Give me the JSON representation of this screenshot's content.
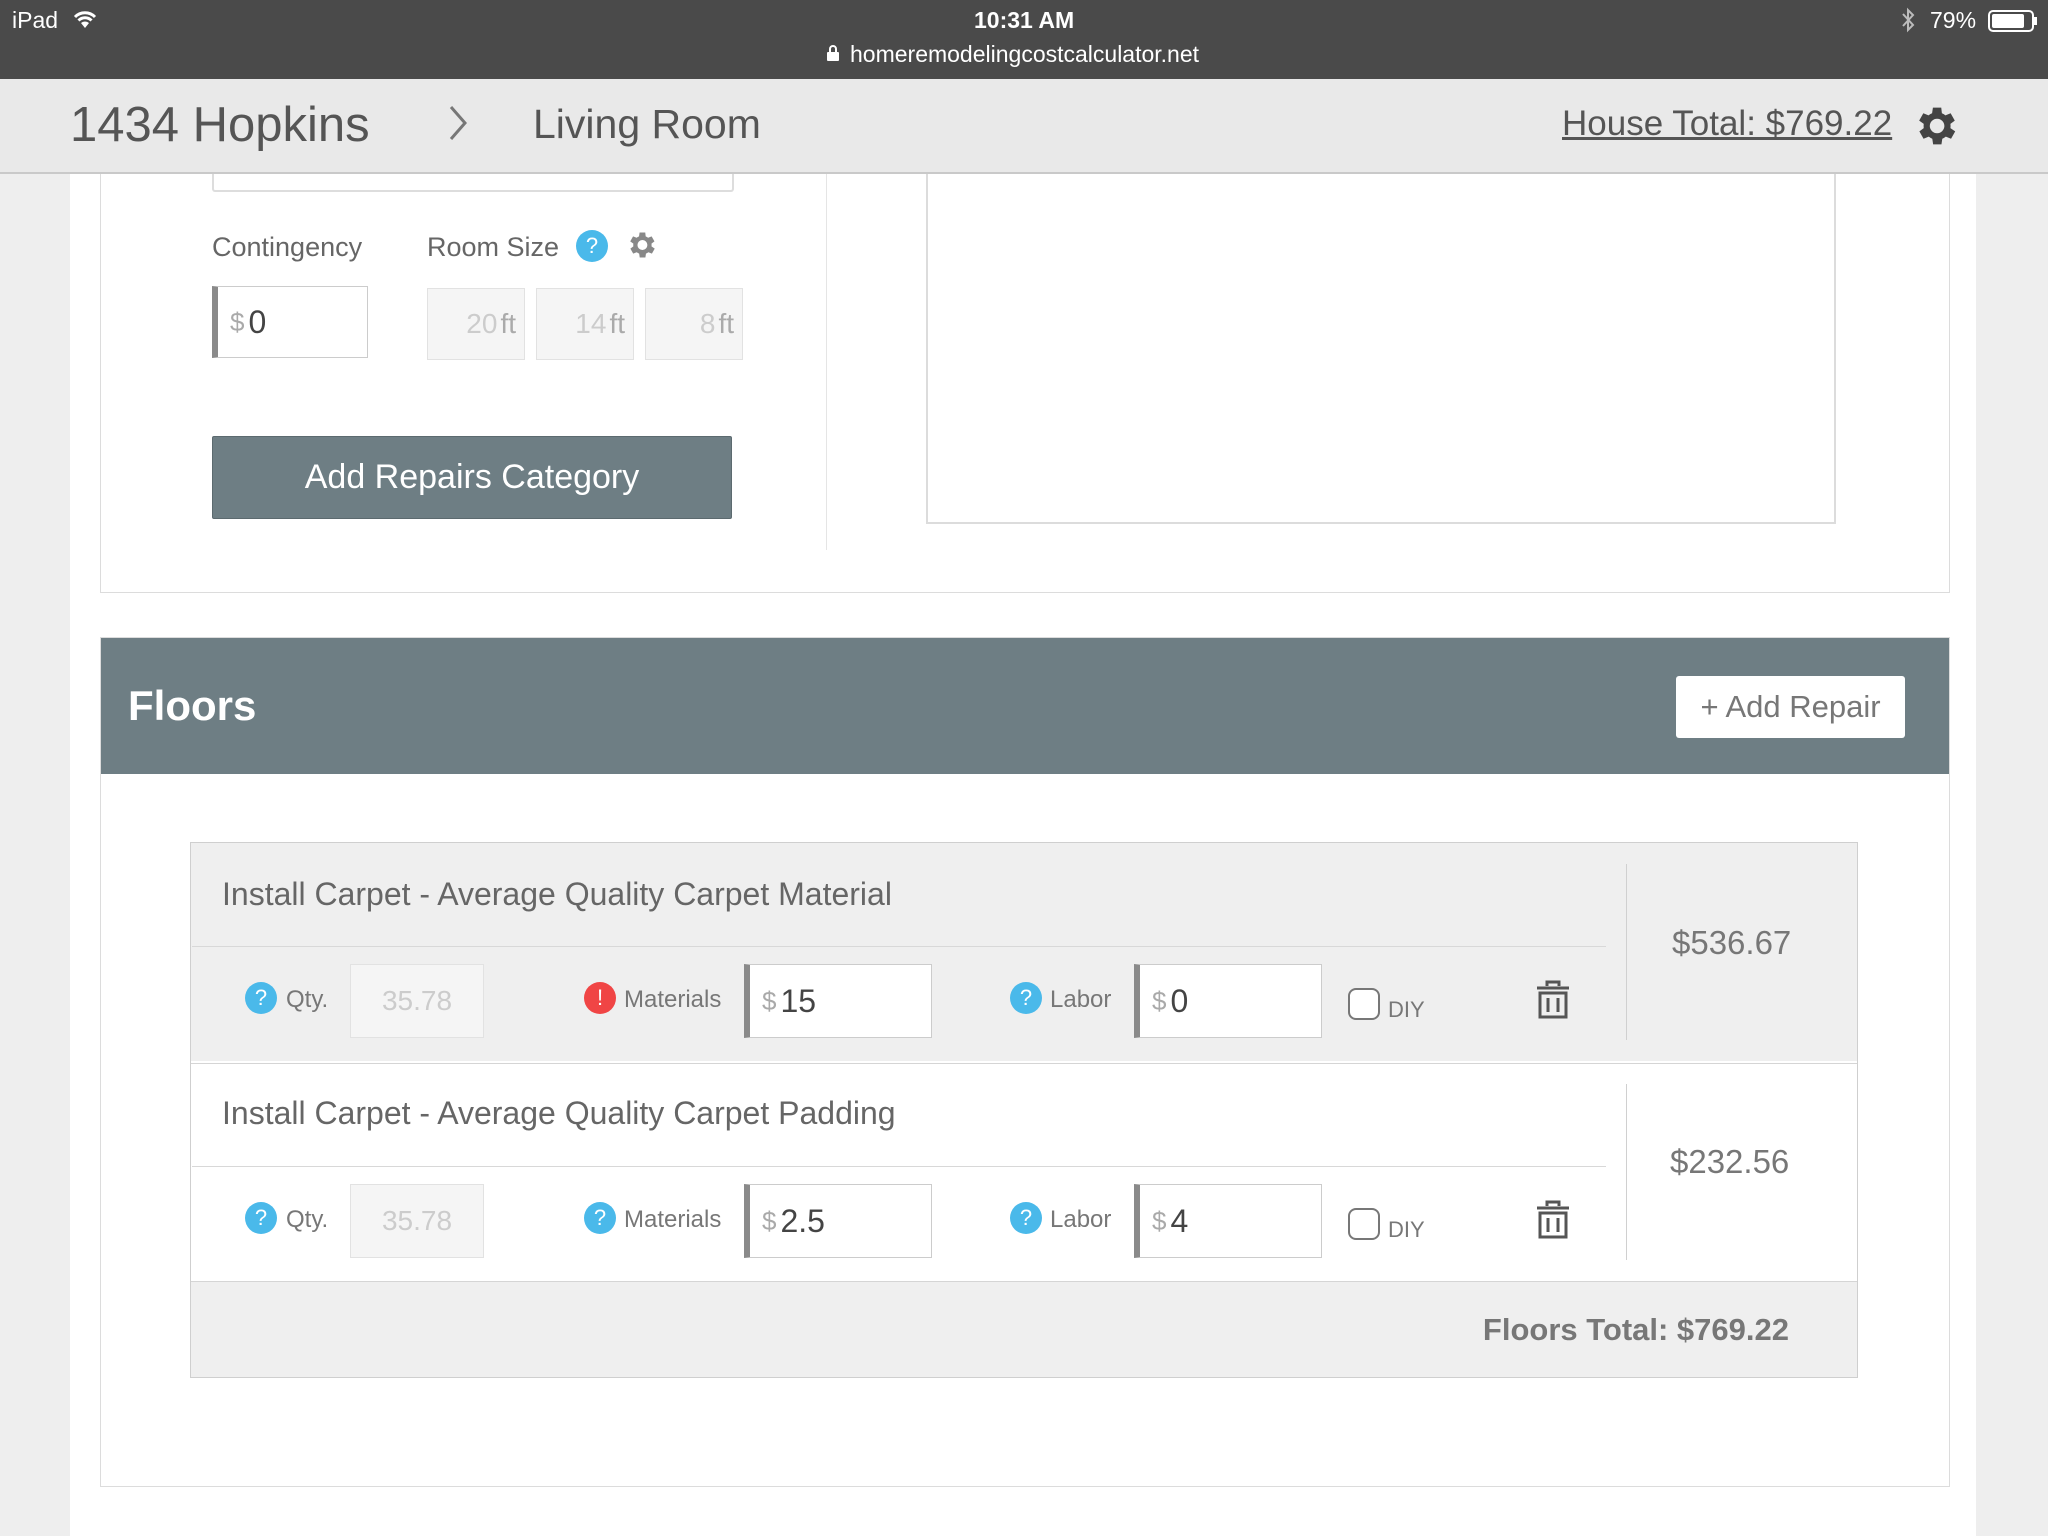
{
  "status_bar": {
    "device": "iPad",
    "time": "10:31 AM",
    "url": "homeremodelingcostcalculator.net",
    "battery": "79%"
  },
  "header": {
    "project": "1434 Hopkins",
    "room": "Living Room",
    "house_total": "House Total: $769.22"
  },
  "room_settings": {
    "contingency_label": "Contingency",
    "contingency_currency": "$",
    "contingency_value": "0",
    "room_size_label": "Room Size",
    "length": "20",
    "width": "14",
    "height": "8",
    "unit": "ft",
    "add_category_label": "Add Repairs Category"
  },
  "floors": {
    "title": "Floors",
    "add_repair_label": "+ Add Repair",
    "items": [
      {
        "name": "Install Carpet - Average Quality Carpet Material",
        "qty_label": "Qty.",
        "qty": "35.78",
        "materials_label": "Materials",
        "materials": "15",
        "labor_label": "Labor",
        "labor": "0",
        "diy_label": "DIY",
        "price": "$536.67"
      },
      {
        "name": "Install Carpet - Average Quality Carpet Padding",
        "qty_label": "Qty.",
        "qty": "35.78",
        "materials_label": "Materials",
        "materials": "2.5",
        "labor_label": "Labor",
        "labor": "4",
        "diy_label": "DIY",
        "price": "$232.56"
      }
    ],
    "total": "Floors Total: $769.22",
    "currency": "$"
  },
  "icons": {
    "help": "?",
    "error": "!"
  },
  "colors": {
    "status_bar": "#4a4a4a",
    "section_header": "#6e7e84",
    "help_icon": "#4ab9ea",
    "error_icon": "#f04545"
  }
}
